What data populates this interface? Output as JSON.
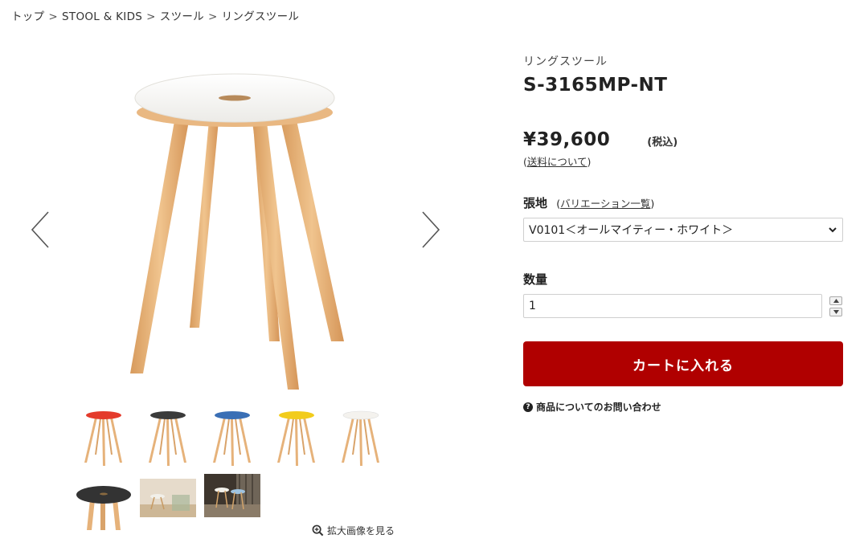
{
  "breadcrumb": {
    "items": [
      "トップ",
      "STOOL & KIDS",
      "スツール",
      "リングスツール"
    ],
    "separator": ">"
  },
  "gallery": {
    "zoom_label": "拡大画像を見る",
    "thumbnails": [
      {
        "seat_color": "#e43b2c",
        "kind": "stool"
      },
      {
        "seat_color": "#3b3b3b",
        "kind": "stool"
      },
      {
        "seat_color": "#3a6fb5",
        "kind": "stool"
      },
      {
        "seat_color": "#f2cc1c",
        "kind": "stool"
      },
      {
        "seat_color": "#f4f2ee",
        "kind": "stool"
      },
      {
        "seat_color": "#333333",
        "kind": "seat-closeup"
      },
      {
        "seat_color": "#d8c7ae",
        "kind": "room-photo"
      },
      {
        "seat_color": "#5a4a3a",
        "kind": "room-photo-dark"
      }
    ]
  },
  "product": {
    "subtitle": "リングスツール",
    "code": "S-3165MP-NT",
    "price": "¥39,600",
    "tax_note": "(税込)",
    "shipping_open": "(",
    "shipping_link": "送料について",
    "shipping_close": ")"
  },
  "fabric": {
    "label": "張地",
    "variation_open": "(",
    "variation_link": "バリエーション一覧",
    "variation_close": ")",
    "selected": "V0101＜オールマイティー・ホワイト＞"
  },
  "quantity": {
    "label": "数量",
    "value": "1"
  },
  "cart": {
    "button_label": "カートに入れる"
  },
  "inquiry": {
    "label": "商品についてのお問い合わせ"
  },
  "colors": {
    "cart_red": "#b00000",
    "wood": "#e6b27a",
    "seat_white": "#f6f5f2"
  }
}
